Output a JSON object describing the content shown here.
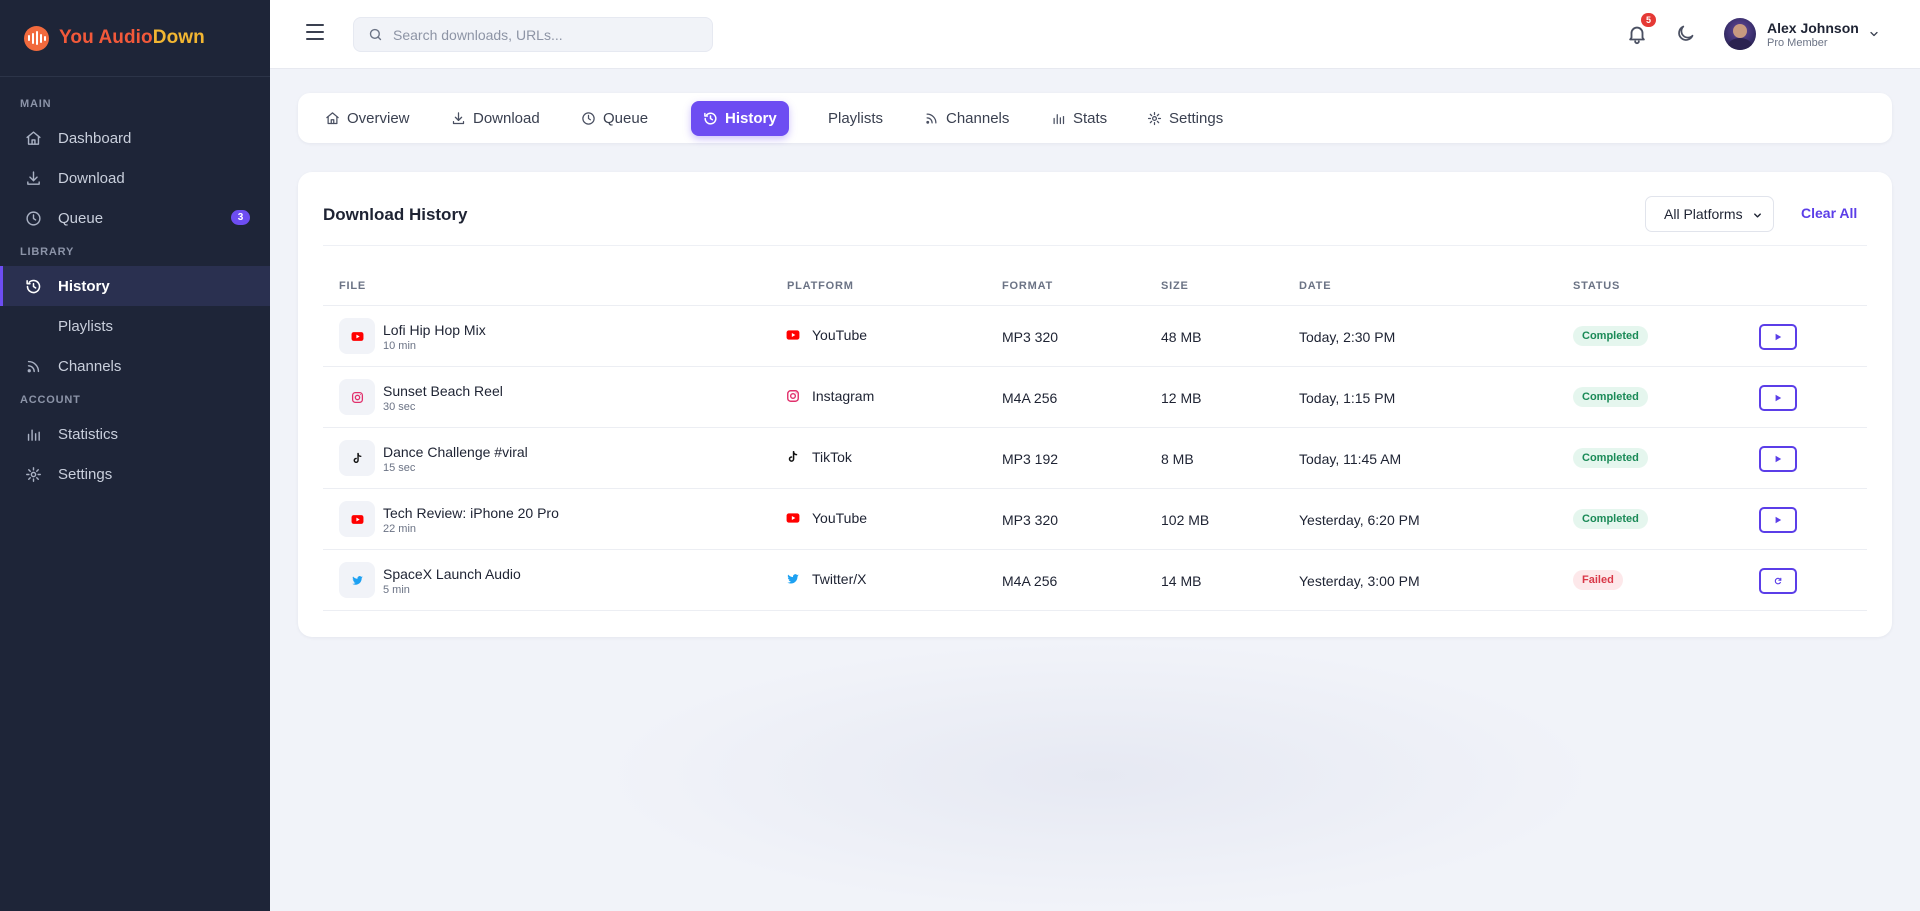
{
  "brand": {
    "part1": "You Audio",
    "part2": "Down"
  },
  "sidebar": {
    "sections": {
      "main": "MAIN",
      "library": "LIBRARY",
      "account": "ACCOUNT"
    },
    "items": [
      {
        "label": "Dashboard",
        "icon": "home-icon"
      },
      {
        "label": "Download",
        "icon": "download-icon"
      },
      {
        "label": "Queue",
        "icon": "clock-icon",
        "badge": "3"
      },
      {
        "label": "History",
        "icon": "history-icon",
        "active": true
      },
      {
        "label": "Playlists",
        "icon": ""
      },
      {
        "label": "Channels",
        "icon": "rss-icon"
      },
      {
        "label": "Statistics",
        "icon": "bar-chart-icon"
      },
      {
        "label": "Settings",
        "icon": "gear-icon"
      }
    ]
  },
  "header": {
    "search_placeholder": "Search downloads, URLs...",
    "notification_count": "5",
    "user": {
      "name": "Alex Johnson",
      "role": "Pro Member"
    }
  },
  "tabs": [
    {
      "label": "Overview",
      "icon": "home-icon"
    },
    {
      "label": "Download",
      "icon": "download-icon"
    },
    {
      "label": "Queue",
      "icon": "clock-icon"
    },
    {
      "label": "History",
      "icon": "history-icon",
      "active": true
    },
    {
      "label": "Playlists",
      "icon": ""
    },
    {
      "label": "Channels",
      "icon": "rss-icon"
    },
    {
      "label": "Stats",
      "icon": "bar-chart-icon"
    },
    {
      "label": "Settings",
      "icon": "gear-icon"
    }
  ],
  "history": {
    "title": "Download History",
    "filter_value": "All Platforms",
    "clear_label": "Clear All",
    "columns": [
      "FILE",
      "PLATFORM",
      "FORMAT",
      "SIZE",
      "DATE",
      "STATUS"
    ],
    "rows": [
      {
        "name": "Lofi Hip Hop Mix",
        "duration": "10 min",
        "platform": "YouTube",
        "format": "MP3 320",
        "size": "48 MB",
        "date": "Today, 2:30 PM",
        "status": "Completed",
        "action": "play"
      },
      {
        "name": "Sunset Beach Reel",
        "duration": "30 sec",
        "platform": "Instagram",
        "format": "M4A 256",
        "size": "12 MB",
        "date": "Today, 1:15 PM",
        "status": "Completed",
        "action": "play"
      },
      {
        "name": "Dance Challenge #viral",
        "duration": "15 sec",
        "platform": "TikTok",
        "format": "MP3 192",
        "size": "8 MB",
        "date": "Today, 11:45 AM",
        "status": "Completed",
        "action": "play"
      },
      {
        "name": "Tech Review: iPhone 20 Pro",
        "duration": "22 min",
        "platform": "YouTube",
        "format": "MP3 320",
        "size": "102 MB",
        "date": "Yesterday, 6:20 PM",
        "status": "Completed",
        "action": "play"
      },
      {
        "name": "SpaceX Launch Audio",
        "duration": "5 min",
        "platform": "Twitter/X",
        "format": "M4A 256",
        "size": "14 MB",
        "date": "Yesterday, 3:00 PM",
        "status": "Failed",
        "action": "retry"
      }
    ]
  },
  "colors": {
    "accent": "#6d4df2",
    "sidebar_bg": "#1e2538",
    "youtube": "#ff0000",
    "instagram": "#e1306c",
    "tiktok": "#111111",
    "twitter": "#1da1f2",
    "success": "#1a8a57",
    "danger": "#d93848"
  }
}
